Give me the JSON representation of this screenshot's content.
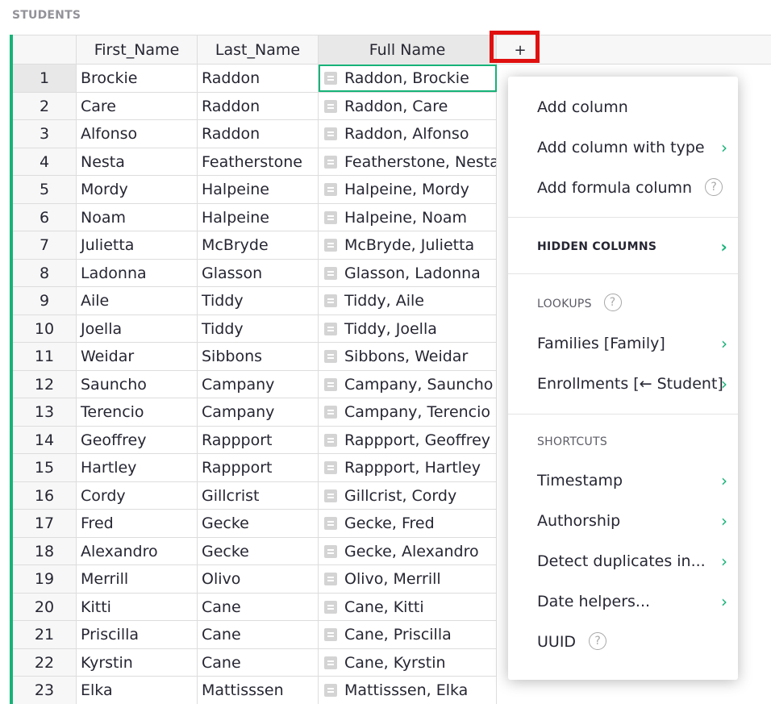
{
  "section_title": "STUDENTS",
  "columns": {
    "first": "First_Name",
    "last": "Last_Name",
    "full": "Full Name",
    "add": "+"
  },
  "rows": [
    {
      "n": "1",
      "first": "Brockie",
      "last": "Raddon",
      "full": "Raddon, Brockie"
    },
    {
      "n": "2",
      "first": "Care",
      "last": "Raddon",
      "full": "Raddon, Care"
    },
    {
      "n": "3",
      "first": "Alfonso",
      "last": "Raddon",
      "full": "Raddon, Alfonso"
    },
    {
      "n": "4",
      "first": "Nesta",
      "last": "Featherstone",
      "full": "Featherstone, Nesta"
    },
    {
      "n": "5",
      "first": "Mordy",
      "last": "Halpeine",
      "full": "Halpeine, Mordy"
    },
    {
      "n": "6",
      "first": "Noam",
      "last": "Halpeine",
      "full": "Halpeine, Noam"
    },
    {
      "n": "7",
      "first": "Julietta",
      "last": "McBryde",
      "full": "McBryde, Julietta"
    },
    {
      "n": "8",
      "first": "Ladonna",
      "last": "Glasson",
      "full": "Glasson, Ladonna"
    },
    {
      "n": "9",
      "first": "Aile",
      "last": "Tiddy",
      "full": "Tiddy, Aile"
    },
    {
      "n": "10",
      "first": "Joella",
      "last": "Tiddy",
      "full": "Tiddy, Joella"
    },
    {
      "n": "11",
      "first": "Weidar",
      "last": "Sibbons",
      "full": "Sibbons, Weidar"
    },
    {
      "n": "12",
      "first": "Sauncho",
      "last": "Campany",
      "full": "Campany, Sauncho"
    },
    {
      "n": "13",
      "first": "Terencio",
      "last": "Campany",
      "full": "Campany, Terencio"
    },
    {
      "n": "14",
      "first": "Geoffrey",
      "last": "Rappport",
      "full": "Rappport, Geoffrey"
    },
    {
      "n": "15",
      "first": "Hartley",
      "last": "Rappport",
      "full": "Rappport, Hartley"
    },
    {
      "n": "16",
      "first": "Cordy",
      "last": "Gillcrist",
      "full": "Gillcrist, Cordy"
    },
    {
      "n": "17",
      "first": "Fred",
      "last": "Gecke",
      "full": "Gecke, Fred"
    },
    {
      "n": "18",
      "first": "Alexandro",
      "last": "Gecke",
      "full": "Gecke, Alexandro"
    },
    {
      "n": "19",
      "first": "Merrill",
      "last": "Olivo",
      "full": "Olivo, Merrill"
    },
    {
      "n": "20",
      "first": "Kitti",
      "last": "Cane",
      "full": "Cane, Kitti"
    },
    {
      "n": "21",
      "first": "Priscilla",
      "last": "Cane",
      "full": "Cane, Priscilla"
    },
    {
      "n": "22",
      "first": "Kyrstin",
      "last": "Cane",
      "full": "Cane, Kyrstin"
    },
    {
      "n": "23",
      "first": "Elka",
      "last": "Mattisssen",
      "full": "Mattisssen, Elka"
    }
  ],
  "menu": {
    "add_column": "Add column",
    "add_column_with_type": "Add column with type",
    "add_formula_column": "Add formula column",
    "help_glyph": "?",
    "chevron_glyph": "›",
    "hidden_columns": "HIDDEN COLUMNS",
    "lookups": "LOOKUPS",
    "families": "Families [Family]",
    "enrollments": "Enrollments [← Student]",
    "shortcuts": "SHORTCUTS",
    "timestamp": "Timestamp",
    "authorship": "Authorship",
    "detect_duplicates": "Detect duplicates in...",
    "date_helpers": "Date helpers...",
    "uuid": "UUID"
  },
  "colors": {
    "accent": "#16b378",
    "highlight": "#e01010"
  }
}
